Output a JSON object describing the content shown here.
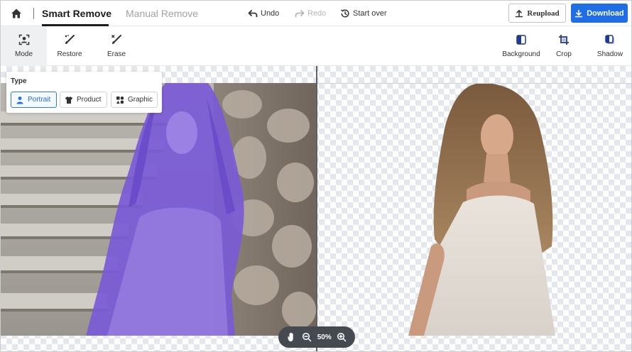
{
  "header": {
    "tabs": [
      {
        "label": "Smart Remove",
        "active": true
      },
      {
        "label": "Manual Remove",
        "active": false
      }
    ],
    "history": {
      "undo": "Undo",
      "redo": "Redo",
      "start_over": "Start over"
    },
    "reupload_label": "Reupload",
    "download_label": "Download"
  },
  "toolbar": {
    "left": [
      {
        "label": "Mode",
        "icon": "mode-icon",
        "active": true
      },
      {
        "label": "Restore",
        "icon": "restore-brush-icon"
      },
      {
        "label": "Erase",
        "icon": "erase-brush-icon"
      }
    ],
    "right": [
      {
        "label": "Background",
        "icon": "background-icon"
      },
      {
        "label": "Crop",
        "icon": "crop-icon"
      },
      {
        "label": "Shadow",
        "icon": "shadow-icon"
      }
    ]
  },
  "type_panel": {
    "title": "Type",
    "options": [
      {
        "label": "Portrait",
        "icon": "portrait-icon",
        "selected": true
      },
      {
        "label": "Product",
        "icon": "shirt-icon",
        "selected": false
      },
      {
        "label": "Graphic",
        "icon": "graphic-icon",
        "selected": false
      }
    ]
  },
  "zoom": {
    "level": "50%"
  },
  "colors": {
    "accent": "#1f6ee6",
    "mask": "#7a5ad6",
    "toolbar_active": "#eef0f2"
  }
}
